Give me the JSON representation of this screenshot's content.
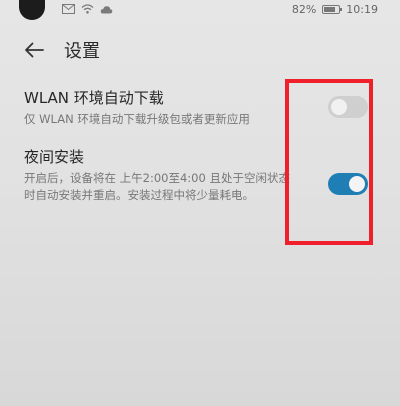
{
  "status_bar": {
    "battery_percent": "82%",
    "time": "10:19",
    "battery_level": 0.82,
    "icons": [
      "mail-icon",
      "wifi-icon",
      "cloud-icon",
      "battery-icon"
    ]
  },
  "header": {
    "back_icon": "arrow-left-icon",
    "title": "设置"
  },
  "settings": [
    {
      "title": "WLAN 环境自动下载",
      "description": "仅 WLAN 环境自动下载升级包或者更新应用",
      "enabled": false
    },
    {
      "title": "夜间安装",
      "description": "开启后，设备将在 上午2:00至4:00 且处于空闲状态时自动安装并重启。安装过程中将少量耗电。",
      "enabled": true
    }
  ],
  "colors": {
    "toggle_on": "#1f7fb5",
    "toggle_off": "#cfcfcf",
    "highlight": "#ef1f2c"
  }
}
